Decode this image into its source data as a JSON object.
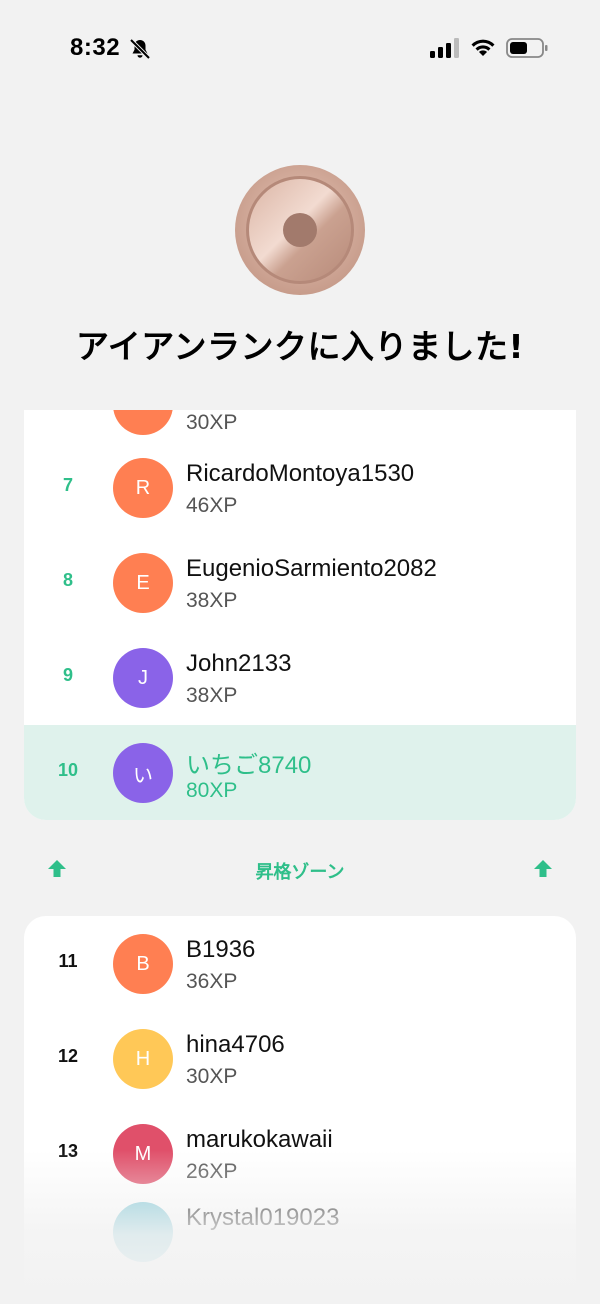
{
  "status_bar": {
    "time": "8:32"
  },
  "header": {
    "title": "アイアンランクに入りました!"
  },
  "colors": {
    "accent_green": "#2fbf8a",
    "highlight_bg": "#dff2ec",
    "avatar_orange": "#ff7f52",
    "avatar_purple": "#8a63e8",
    "avatar_yellow": "#ffc857",
    "avatar_pink": "#e0506a",
    "avatar_teal": "#7cc7d6"
  },
  "leaderboard_top": {
    "partial_row": {
      "xp": "30XP"
    },
    "rows": [
      {
        "rank": "7",
        "initial": "R",
        "name": "RicardoMontoya1530",
        "xp": "46XP"
      },
      {
        "rank": "8",
        "initial": "E",
        "name": "EugenioSarmiento2082",
        "xp": "38XP"
      },
      {
        "rank": "9",
        "initial": "J",
        "name": "John2133",
        "xp": "38XP"
      },
      {
        "rank": "10",
        "initial": "い",
        "name": "いちご8740",
        "xp": "80XP"
      }
    ]
  },
  "promotion_zone": {
    "label": "昇格ゾーン"
  },
  "leaderboard_bottom": {
    "rows": [
      {
        "rank": "11",
        "initial": "B",
        "name": "B1936",
        "xp": "36XP"
      },
      {
        "rank": "12",
        "initial": "H",
        "name": "hina4706",
        "xp": "30XP"
      },
      {
        "rank": "13",
        "initial": "M",
        "name": "marukokawaii",
        "xp": "26XP"
      },
      {
        "rank": "",
        "initial": "",
        "name": "Krystal019023",
        "xp": ""
      }
    ]
  }
}
